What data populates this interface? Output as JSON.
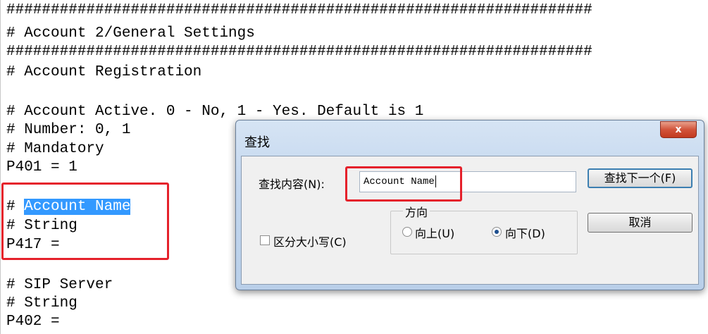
{
  "editor": {
    "lines": [
      "##################################################################",
      "# Account 2/General Settings",
      "##################################################################",
      "# Account Registration",
      "",
      "# Account Active. 0 - No, 1 - Yes. Default is 1",
      "# Number: 0, 1",
      "# Mandatory",
      "P401 = 1",
      "",
      "# ",
      "# String",
      "P417 =",
      "",
      "# SIP Server",
      "# String",
      "P402 ="
    ],
    "selected_text": "Account Name"
  },
  "dialog": {
    "title": "查找",
    "close_glyph": "x",
    "find_label": "查找内容(N):",
    "find_value": "Account Name",
    "find_next_label": "查找下一个(F)",
    "cancel_label": "取消",
    "direction_label": "方向",
    "up_label": "向上(U)",
    "down_label": "向下(D)",
    "match_case_label": "区分大小写(C)",
    "selected_direction": "down",
    "match_case_checked": false
  },
  "colors": {
    "highlight": "#3399ff",
    "annotation_box": "#e5212b"
  }
}
